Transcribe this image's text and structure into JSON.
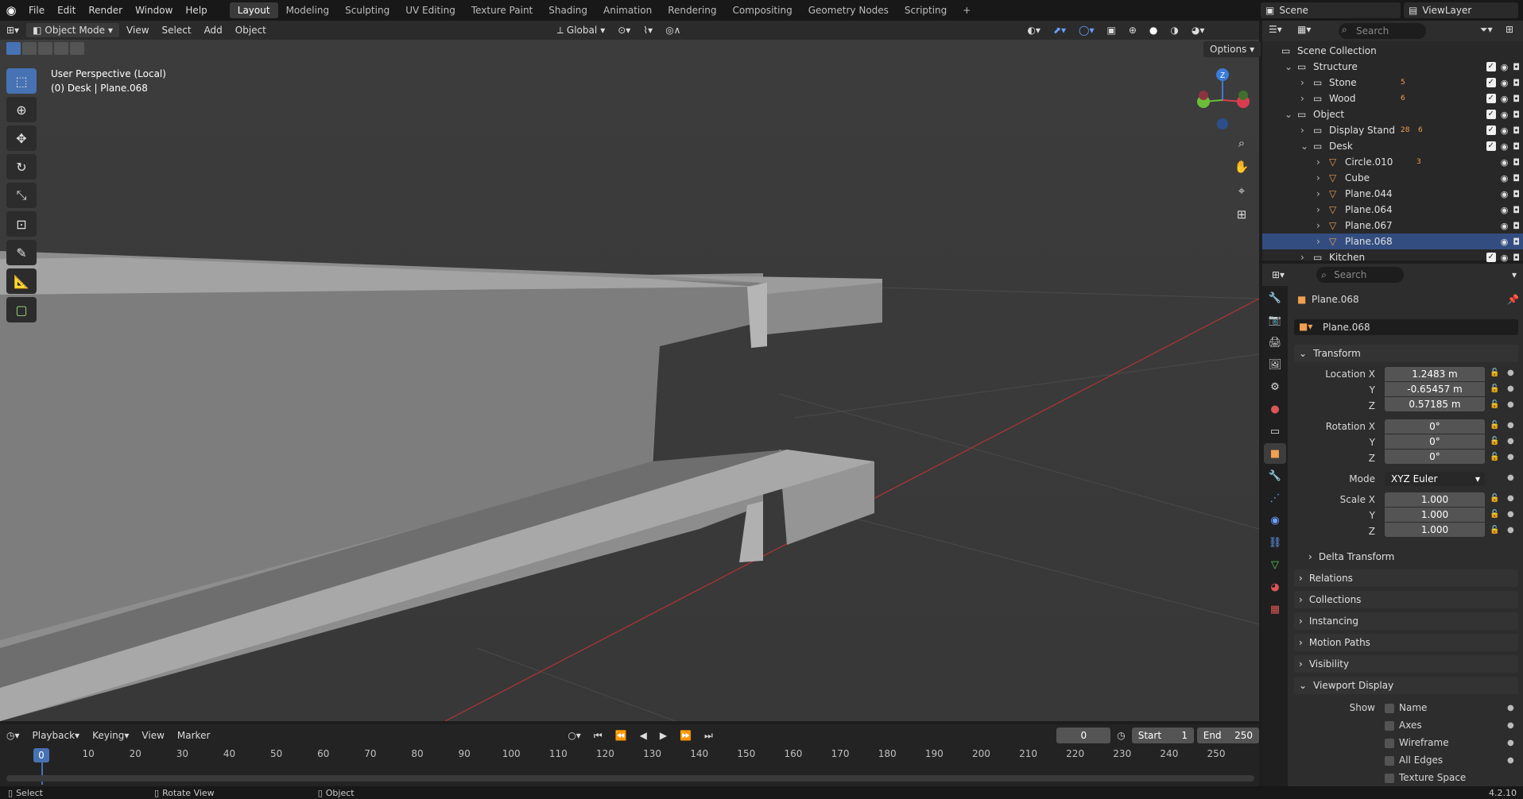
{
  "topbar": {
    "menus": [
      "File",
      "Edit",
      "Render",
      "Window",
      "Help"
    ],
    "workspaces": [
      "Layout",
      "Modeling",
      "Sculpting",
      "UV Editing",
      "Texture Paint",
      "Shading",
      "Animation",
      "Rendering",
      "Compositing",
      "Geometry Nodes",
      "Scripting"
    ],
    "active_workspace": "Layout",
    "add_tab": "+",
    "scene": "Scene",
    "view_layer": "ViewLayer"
  },
  "viewport": {
    "mode": "Object Mode",
    "menus": [
      "View",
      "Select",
      "Add",
      "Object"
    ],
    "orientation": "Global",
    "options_label": "Options",
    "perspective_label": "User Perspective (Local)",
    "object_label": "(0) Desk | Plane.068",
    "gizmo": {
      "z_label": "Z",
      "x_color": "#d93c4e",
      "y_color": "#6dbd3b",
      "z_color": "#3b7ad8"
    },
    "icons": [
      "zoom-icon",
      "hand-icon",
      "camera-icon",
      "grid-icon"
    ]
  },
  "tools": [
    "select-box",
    "cursor",
    "move",
    "rotate",
    "scale",
    "transform",
    "annotate",
    "measure",
    "add-cube"
  ],
  "outliner": {
    "search_placeholder": "Search",
    "rows": [
      {
        "label": "Scene Collection",
        "depth": 0,
        "type": "scene",
        "toggles": false
      },
      {
        "label": "Structure",
        "depth": 1,
        "type": "collection",
        "expanded": true,
        "toggles": true,
        "check": true
      },
      {
        "label": "Stone",
        "depth": 2,
        "type": "collection",
        "toggles": true,
        "check": true,
        "badge": "5"
      },
      {
        "label": "Wood",
        "depth": 2,
        "type": "collection",
        "toggles": true,
        "check": true,
        "badge": "6"
      },
      {
        "label": "Object",
        "depth": 1,
        "type": "collection",
        "expanded": true,
        "toggles": true,
        "check": true
      },
      {
        "label": "Display Stand",
        "depth": 2,
        "type": "collection",
        "toggles": true,
        "check": true,
        "badge": "28",
        "badge2": "6"
      },
      {
        "label": "Desk",
        "depth": 2,
        "type": "collection",
        "expanded": true,
        "toggles": true,
        "check": true
      },
      {
        "label": "Circle.010",
        "depth": 3,
        "type": "mesh",
        "toggles": true,
        "badge": "3"
      },
      {
        "label": "Cube",
        "depth": 3,
        "type": "mesh",
        "toggles": true
      },
      {
        "label": "Plane.044",
        "depth": 3,
        "type": "mesh",
        "toggles": true
      },
      {
        "label": "Plane.064",
        "depth": 3,
        "type": "mesh",
        "toggles": true
      },
      {
        "label": "Plane.067",
        "depth": 3,
        "type": "mesh",
        "toggles": true
      },
      {
        "label": "Plane.068",
        "depth": 3,
        "type": "mesh",
        "toggles": true,
        "selected": true
      },
      {
        "label": "Kitchen",
        "depth": 2,
        "type": "collection",
        "toggles": true,
        "check": true
      }
    ]
  },
  "properties": {
    "search_placeholder": "Search",
    "object_name": "Plane.068",
    "datablock_name": "Plane.068",
    "transform_label": "Transform",
    "location_label": "Location X",
    "location": [
      "1.2483 m",
      "-0.65457 m",
      "0.57185 m"
    ],
    "rotation_label": "Rotation X",
    "rotation": [
      "0°",
      "0°",
      "0°"
    ],
    "mode_label": "Mode",
    "mode_value": "XYZ Euler",
    "scale_label": "Scale X",
    "scale": [
      "1.000",
      "1.000",
      "1.000"
    ],
    "axis_y": "Y",
    "axis_z": "Z",
    "delta_label": "Delta Transform",
    "panels": [
      "Relations",
      "Collections",
      "Instancing",
      "Motion Paths",
      "Visibility"
    ],
    "viewport_display_label": "Viewport Display",
    "show_label": "Show",
    "show_items": [
      "Name",
      "Axes",
      "Wireframe",
      "All Edges",
      "Texture Space"
    ]
  },
  "timeline": {
    "menus": [
      "Playback",
      "Keying",
      "View",
      "Marker"
    ],
    "current_frame": "0",
    "start_label": "Start",
    "start": "1",
    "end_label": "End",
    "end": "250",
    "ticks": [
      "10",
      "20",
      "30",
      "40",
      "50",
      "60",
      "70",
      "80",
      "90",
      "100",
      "110",
      "120",
      "130",
      "140",
      "150",
      "160",
      "170",
      "180",
      "190",
      "200",
      "210",
      "220",
      "230",
      "240",
      "250"
    ],
    "playhead": "0"
  },
  "statusbar": {
    "items": [
      "Select",
      "Rotate View",
      "Object"
    ],
    "version": "4.2.10"
  }
}
